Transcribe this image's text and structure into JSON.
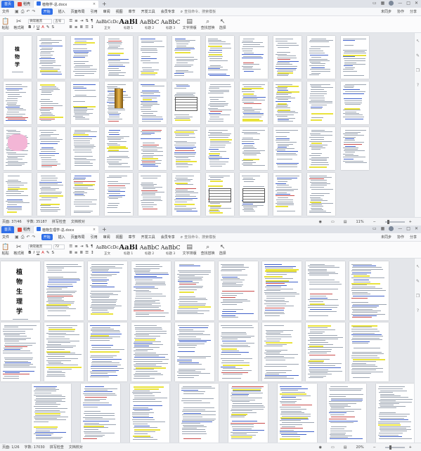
{
  "windows": [
    {
      "tabs": {
        "home": "首页",
        "straw": "稻壳",
        "doc": "植物学-总.docx"
      },
      "menu": {
        "file": "文件",
        "items": [
          "开始",
          "插入",
          "页面布局",
          "引用",
          "审阅",
          "视图",
          "章节",
          "开发工具",
          "会员专享"
        ],
        "active_index": 0,
        "search": "查找命令、搜索模板",
        "right": [
          "未同步",
          "协作",
          "分享"
        ]
      },
      "ribbon": {
        "paste": "粘贴",
        "cut": "剪切",
        "format_painter": "格式刷",
        "font": "微软雅黑",
        "font_size": "五号",
        "styles": [
          {
            "sample": "AaBbCcDc",
            "name": "正文"
          },
          {
            "sample": "AaBl",
            "name": "标题 1"
          },
          {
            "sample": "AaBbC",
            "name": "标题 2"
          },
          {
            "sample": "AaBbC",
            "name": "标题 3"
          }
        ],
        "text_tools": "文字排版",
        "find_replace": "查找替换",
        "select": "选择"
      },
      "status": {
        "page": "页面: 37/46",
        "words": "字数: 35187",
        "spell": "拼写检查",
        "proof": "文档校对",
        "zoom": "11%"
      }
    },
    {
      "tabs": {
        "home": "首页",
        "straw": "稻壳",
        "doc": "植物生理学-总.docx"
      },
      "menu": {
        "file": "文件",
        "items": [
          "开始",
          "插入",
          "页面布局",
          "引用",
          "审阅",
          "视图",
          "章节",
          "开发工具",
          "会员专享"
        ],
        "active_index": 0,
        "search": "查找命令、搜索模板",
        "right": [
          "未同步",
          "协作",
          "分享"
        ]
      },
      "ribbon": {
        "paste": "粘贴",
        "cut": "剪切",
        "format_painter": "格式刷",
        "font": "微软雅黑",
        "font_size": "72",
        "styles": [
          {
            "sample": "AaBbCcDc",
            "name": "正文"
          },
          {
            "sample": "AaBl",
            "name": "标题 1"
          },
          {
            "sample": "AaBbC",
            "name": "标题 2"
          },
          {
            "sample": "AaBbC",
            "name": "标题 3"
          }
        ],
        "text_tools": "文字排版",
        "find_replace": "查找替换",
        "select": "选择"
      },
      "status": {
        "page": "页面: 1/26",
        "words": "字数: 17030",
        "spell": "拼写检查",
        "proof": "文档校对",
        "zoom": "20%"
      }
    }
  ],
  "doc1_cover": {
    "title_chars": [
      "植",
      "物",
      "学"
    ]
  },
  "doc2_cover": {
    "title_chars": [
      "植",
      "物",
      "生",
      "理",
      "学"
    ]
  }
}
